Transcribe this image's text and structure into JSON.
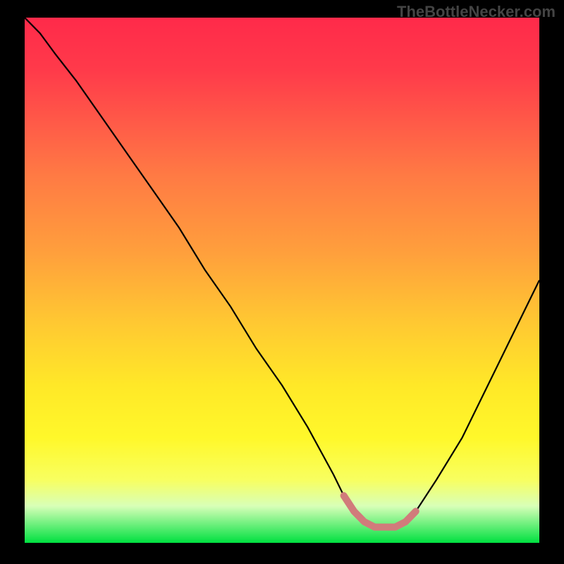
{
  "watermark": "TheBottleNecker.com",
  "chart_data": {
    "type": "line",
    "title": "",
    "xlabel": "",
    "ylabel": "",
    "xlim": [
      0,
      100
    ],
    "ylim": [
      0,
      100
    ],
    "series": [
      {
        "name": "bottleneck-curve",
        "x": [
          0,
          3,
          6,
          10,
          15,
          20,
          25,
          30,
          35,
          40,
          45,
          50,
          55,
          60,
          62,
          64,
          66,
          68,
          70,
          72,
          74,
          76,
          80,
          85,
          90,
          95,
          100
        ],
        "y": [
          100,
          97,
          93,
          88,
          81,
          74,
          67,
          60,
          52,
          45,
          37,
          30,
          22,
          13,
          9,
          6,
          4,
          3,
          3,
          3,
          4,
          6,
          12,
          20,
          30,
          40,
          50
        ]
      },
      {
        "name": "highlight-segment",
        "x": [
          62,
          64,
          66,
          68,
          70,
          72,
          74,
          76
        ],
        "y": [
          9,
          6,
          4,
          3,
          3,
          3,
          4,
          6
        ]
      }
    ],
    "gradient_stops": [
      {
        "pos": 0,
        "color": "#ff2a4a"
      },
      {
        "pos": 10,
        "color": "#ff3a4a"
      },
      {
        "pos": 20,
        "color": "#ff5a48"
      },
      {
        "pos": 30,
        "color": "#ff7a44"
      },
      {
        "pos": 45,
        "color": "#ffa03c"
      },
      {
        "pos": 58,
        "color": "#ffc832"
      },
      {
        "pos": 70,
        "color": "#ffe828"
      },
      {
        "pos": 80,
        "color": "#fff82a"
      },
      {
        "pos": 88,
        "color": "#f8ff60"
      },
      {
        "pos": 93,
        "color": "#d8ffb8"
      },
      {
        "pos": 100,
        "color": "#00e040"
      }
    ]
  }
}
